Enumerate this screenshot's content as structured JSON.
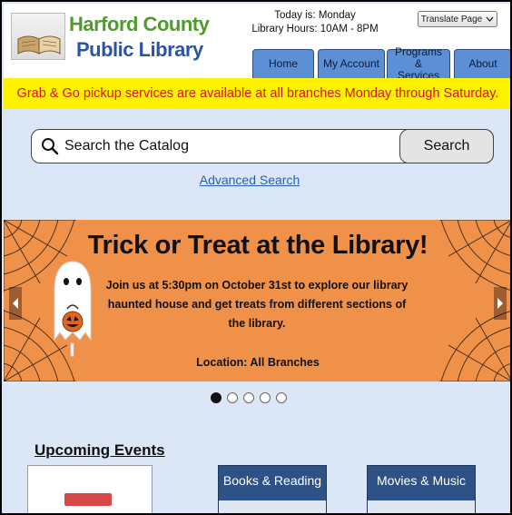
{
  "header": {
    "brand_line1": "Harford County",
    "brand_line2": "Public Library",
    "today": "Today is: Monday",
    "hours": "Library Hours: 10AM - 8PM",
    "translate_label": "Translate Page"
  },
  "nav": {
    "tabs": [
      {
        "label": "Home"
      },
      {
        "label": "My Account"
      },
      {
        "label": "Programs & Services"
      },
      {
        "label": "About"
      }
    ]
  },
  "alert": {
    "text": "Grab & Go pickup services are available at all branches Monday through Saturday."
  },
  "search": {
    "placeholder": "Search the Catalog",
    "button_label": "Search",
    "advanced_link": "Advanced Search"
  },
  "banner": {
    "title": "Trick or Treat at the Library!",
    "description": "Join us at 5:30pm on October 31st to explore our library haunted house and get treats from different sections of the library.",
    "location": "Location: All Branches",
    "slides_total": 5,
    "active_slide": 1
  },
  "events": {
    "title": "Upcoming Events",
    "categories": [
      {
        "label": "Books & Reading"
      },
      {
        "label": "Movies & Music"
      }
    ]
  },
  "colors": {
    "brand_green": "#4e9b2b",
    "brand_blue": "#2a54a6",
    "tab_blue": "#5b8fd6",
    "alert_yellow": "#fff200",
    "alert_red": "#d6141e",
    "banner_orange": "#f0914a",
    "page_bg": "#dbe6f7"
  }
}
